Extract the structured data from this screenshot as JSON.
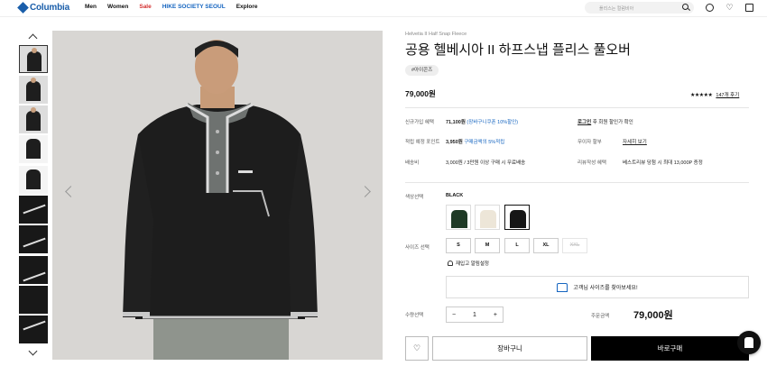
{
  "header": {
    "logo": "Columbia",
    "nav": [
      "Men",
      "Women",
      "Sale",
      "HIKE SOCIETY SEOUL",
      "Explore"
    ],
    "search_placeholder": "플리스는 컬럼비아"
  },
  "product": {
    "subtitle": "Helvetia II Half Snap Fleece",
    "title": "공용 헬베시아 II 하프스냅 플리스 풀오버",
    "tag": "#아이콘즈",
    "price": "79,000원",
    "stars": "★★★★★",
    "rating_value": 4.5,
    "reviews": "147개 후기"
  },
  "benefits": {
    "signup_label": "신규가입 혜택",
    "signup_amount": "71,100원",
    "signup_note": "(장바구니쿠폰 10%할인)",
    "login_text": "로그인",
    "login_suffix": " 후 회원 할인가 확인",
    "points_label": "적립 예정 포인트",
    "points_amount": "3,950원",
    "points_note": "구매금액의 5%적립",
    "installment_label": "무이자 할부",
    "installment_link": "자세히 보기",
    "shipping_label": "배송비",
    "shipping_text": "3,000원 / 3만원 이상 구매 시 무료배송",
    "review_label": "리뷰작성 혜택",
    "review_text": "베스트리뷰 당첨 시 최대 13,000P 증정"
  },
  "options": {
    "color_label": "색상선택",
    "color_selected": "BLACK",
    "colors": [
      {
        "name": "dark-green",
        "hex": "#1f3a26"
      },
      {
        "name": "cream",
        "hex": "#ede6d8"
      },
      {
        "name": "black",
        "hex": "#161616"
      }
    ],
    "size_label": "사이즈 선택",
    "sizes": [
      "S",
      "M",
      "L",
      "XL",
      "XXL"
    ],
    "restock": "재입고 알림설정",
    "size_finder": "고객님 사이즈를 찾아보세요!"
  },
  "purchase": {
    "qty_label": "수량선택",
    "qty": "1",
    "minus": "−",
    "plus": "+",
    "total_label": "주문금액",
    "total": "79,000원",
    "wish_icon": "♡",
    "cart": "장바구니",
    "buy": "바로구매"
  },
  "colors": {
    "brand": "#1a5eaa",
    "sale": "#d32f2f",
    "link_blue": "#1565c0"
  }
}
